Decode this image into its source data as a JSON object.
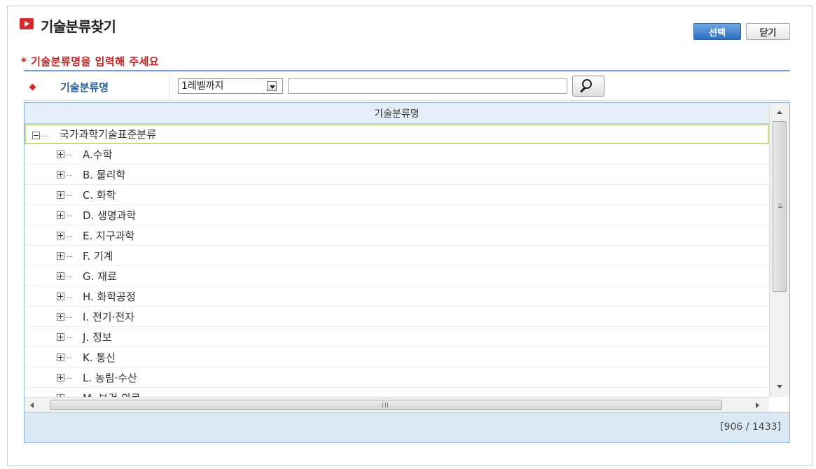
{
  "title": "기술분류찾기",
  "buttons": {
    "select": "선택",
    "close": "닫기"
  },
  "notice": "* 기술분류명을 입력해 주세요",
  "search": {
    "label": "기술분류명",
    "level_value": "1레벨까지",
    "input_value": ""
  },
  "grid": {
    "column_header": "기술분류명",
    "root": "국가과학기술표준분류",
    "items": [
      "A.수학",
      "B. 물리학",
      "C. 화학",
      "D. 생명과학",
      "E. 지구과학",
      "F. 기계",
      "G. 재료",
      "H. 화학공정",
      "I. 전기·전자",
      "J. 정보",
      "K. 통신",
      "L. 농림·수산",
      "M. 보건·의료"
    ],
    "count": "[906 / 1433]"
  },
  "icons": {
    "title_icon": "play-box-icon",
    "search_button": "magnifier-icon",
    "expand": "tree-plus-icon",
    "collapse": "tree-minus-icon"
  },
  "colors": {
    "accent_red": "#d22a2a",
    "select_button": "#2f6fc0",
    "header_bg": "#e4eef8",
    "root_highlight": "#c8de7a"
  }
}
